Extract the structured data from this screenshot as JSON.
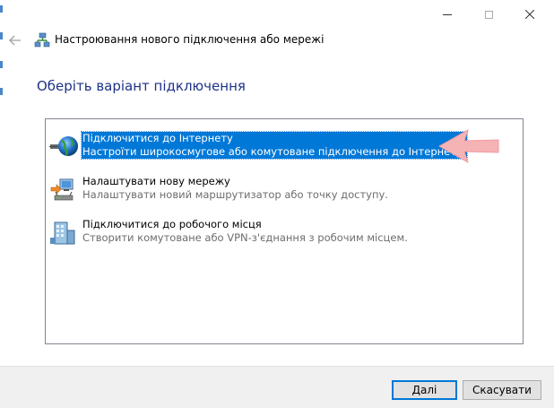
{
  "wizard": {
    "title": "Настроювання нового підключення або мережі",
    "heading": "Оберіть варіант підключення"
  },
  "options": [
    {
      "title": "Підключитися до Інтернету",
      "description": "Настроїти широкосмугове або комутоване підключення до Інтернету.",
      "icon": "globe-network-icon",
      "selected": true
    },
    {
      "title": "Налаштувати нову мережу",
      "description": "Налаштувати новий маршрутизатор або точку доступу.",
      "icon": "router-setup-icon",
      "selected": false
    },
    {
      "title": "Підключитися до робочого місця",
      "description": "Створити комутоване або VPN-з'єднання з робочим місцем.",
      "icon": "workplace-building-icon",
      "selected": false
    }
  ],
  "footer": {
    "next_label": "Далі",
    "cancel_label": "Скасувати"
  },
  "colors": {
    "accent": "#0078d7",
    "heading": "#1e3287",
    "annotation_arrow": "#f4a3a8"
  }
}
